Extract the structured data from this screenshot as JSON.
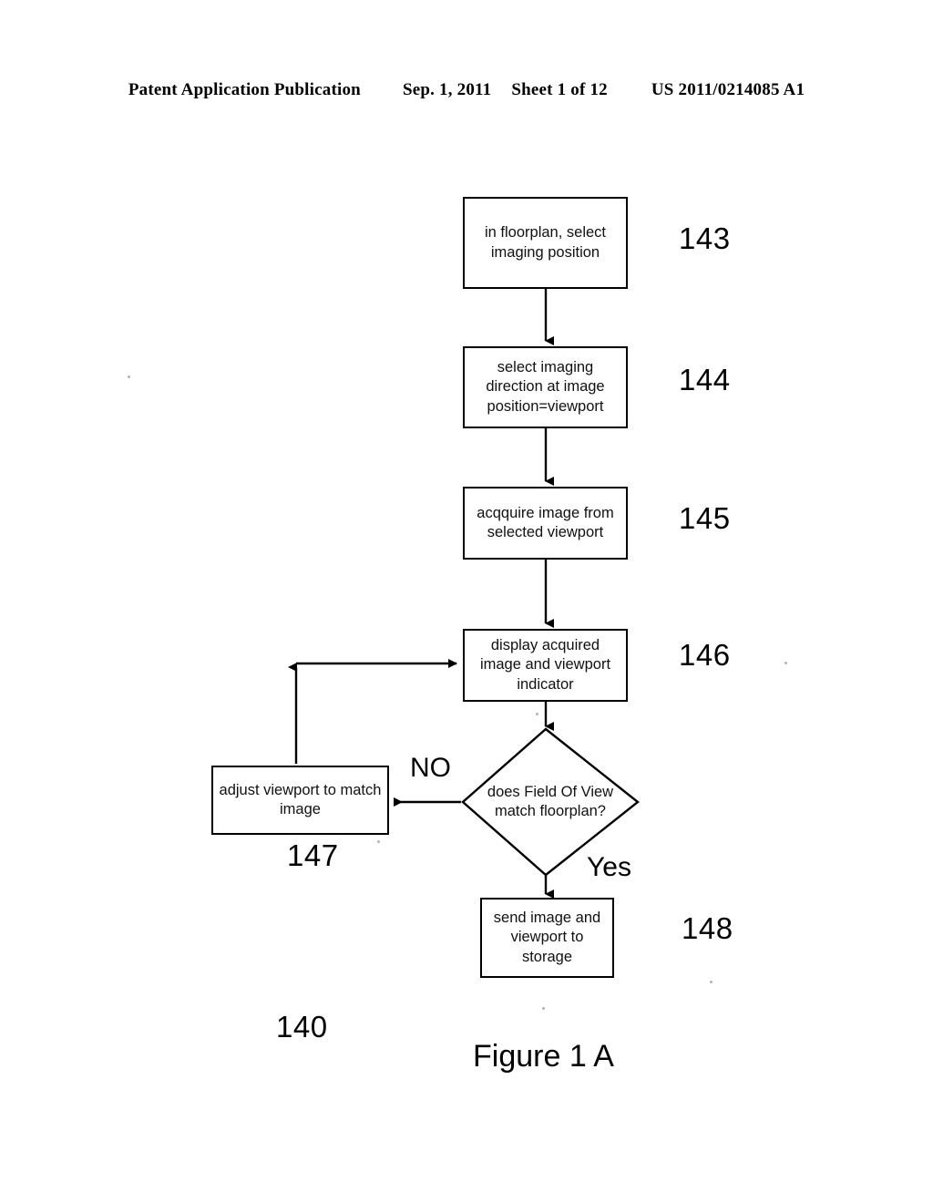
{
  "header": {
    "publication": "Patent Application Publication",
    "date": "Sep. 1, 2011",
    "sheet": "Sheet 1 of 12",
    "number": "US 2011/0214085 A1"
  },
  "figure": {
    "caption": "Figure 1 A",
    "diagram_ref": "140",
    "type": "flowchart",
    "nodes": [
      {
        "id": "143",
        "shape": "process",
        "text": "in floorplan, select imaging position",
        "ref": "143"
      },
      {
        "id": "144",
        "shape": "process",
        "text": "select imaging direction at image position=viewport",
        "ref": "144"
      },
      {
        "id": "145",
        "shape": "process",
        "text": "acqquire image from selected viewport",
        "ref": "145"
      },
      {
        "id": "146",
        "shape": "process",
        "text": "display acquired image and viewport indicator",
        "ref": "146"
      },
      {
        "id": "decision",
        "shape": "decision",
        "text": "does Field Of View match floorplan?",
        "ref": ""
      },
      {
        "id": "147",
        "shape": "process",
        "text": "adjust viewport to match image",
        "ref": "147"
      },
      {
        "id": "148",
        "shape": "process",
        "text": "send image and viewport to storage",
        "ref": "148"
      }
    ],
    "branch_labels": {
      "no": "NO",
      "yes": "Yes"
    }
  },
  "colors": {
    "ink": "#000000",
    "page": "#ffffff"
  }
}
